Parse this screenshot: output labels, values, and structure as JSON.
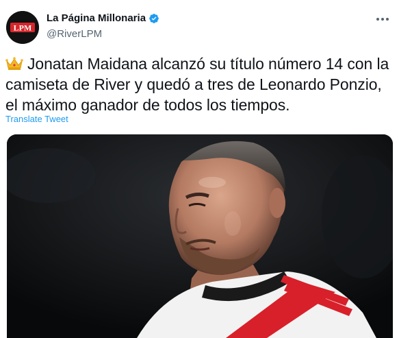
{
  "author": {
    "display_name": "La Página Millonaria",
    "handle": "@RiverLPM",
    "avatar_text": "LPM",
    "verified": true
  },
  "tweet": {
    "emoji": "crown-emoji",
    "text": "Jonatan Maidana alcanzó su título número 14 con la camiseta de River y quedó a tres de Leonardo Ponzio, el máximo ganador de todos los tiempos.",
    "translate_label": "Translate Tweet"
  },
  "icons": {
    "more": "more-dots-icon",
    "verified": "verified-badge-icon"
  },
  "colors": {
    "link": "#1d9bf0",
    "secondary_text": "#536471",
    "verified": "#1d9bf0",
    "avatar_accent": "#d7262b"
  }
}
